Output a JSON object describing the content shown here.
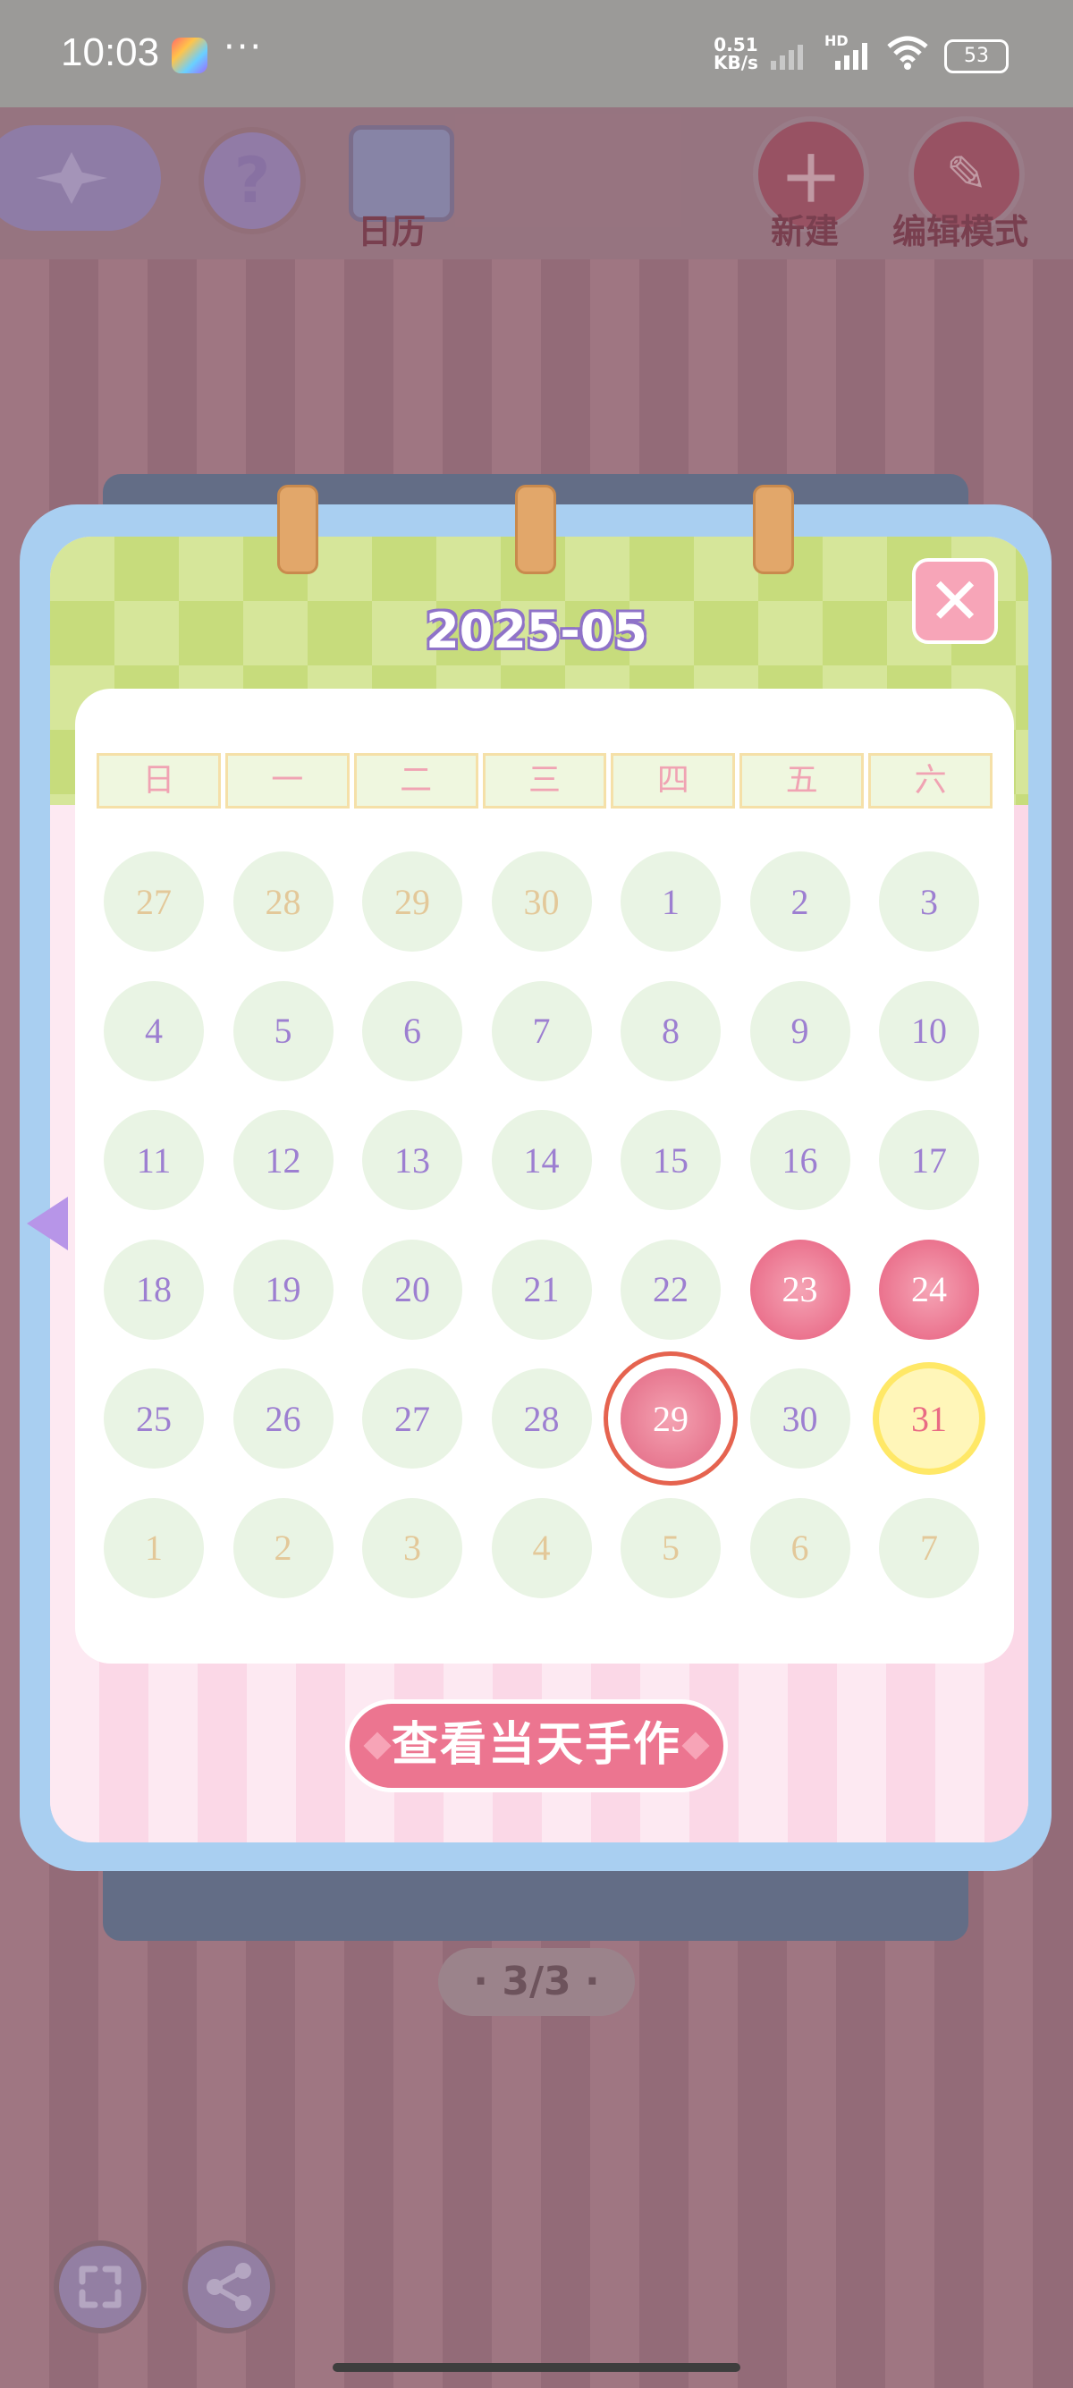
{
  "status_bar": {
    "time": "10:03",
    "more": "···",
    "net_speed_value": "0.51",
    "net_speed_unit": "KB/s",
    "hd": "HD",
    "battery": "53"
  },
  "toolbar": {
    "calendar_label": "日历",
    "help_glyph": "?",
    "new_label": "新建",
    "edit_mode_label": "编辑模式"
  },
  "calendar": {
    "title": "2025-05",
    "close_glyph": "✕",
    "weekdays": [
      "日",
      "一",
      "二",
      "三",
      "四",
      "五",
      "六"
    ],
    "weeks": [
      [
        {
          "d": "27",
          "s": "other"
        },
        {
          "d": "28",
          "s": "other"
        },
        {
          "d": "29",
          "s": "other"
        },
        {
          "d": "30",
          "s": "other"
        },
        {
          "d": "1",
          "s": "normal"
        },
        {
          "d": "2",
          "s": "normal"
        },
        {
          "d": "3",
          "s": "normal"
        }
      ],
      [
        {
          "d": "4",
          "s": "normal"
        },
        {
          "d": "5",
          "s": "normal"
        },
        {
          "d": "6",
          "s": "normal"
        },
        {
          "d": "7",
          "s": "normal"
        },
        {
          "d": "8",
          "s": "normal"
        },
        {
          "d": "9",
          "s": "normal"
        },
        {
          "d": "10",
          "s": "normal"
        }
      ],
      [
        {
          "d": "11",
          "s": "normal"
        },
        {
          "d": "12",
          "s": "normal"
        },
        {
          "d": "13",
          "s": "normal"
        },
        {
          "d": "14",
          "s": "normal"
        },
        {
          "d": "15",
          "s": "normal"
        },
        {
          "d": "16",
          "s": "normal"
        },
        {
          "d": "17",
          "s": "normal"
        }
      ],
      [
        {
          "d": "18",
          "s": "normal"
        },
        {
          "d": "19",
          "s": "normal"
        },
        {
          "d": "20",
          "s": "normal"
        },
        {
          "d": "21",
          "s": "normal"
        },
        {
          "d": "22",
          "s": "normal"
        },
        {
          "d": "23",
          "s": "marked"
        },
        {
          "d": "24",
          "s": "marked"
        }
      ],
      [
        {
          "d": "25",
          "s": "normal"
        },
        {
          "d": "26",
          "s": "normal"
        },
        {
          "d": "27",
          "s": "normal"
        },
        {
          "d": "28",
          "s": "normal"
        },
        {
          "d": "29",
          "s": "today"
        },
        {
          "d": "30",
          "s": "normal"
        },
        {
          "d": "31",
          "s": "selected"
        }
      ],
      [
        {
          "d": "1",
          "s": "other"
        },
        {
          "d": "2",
          "s": "other"
        },
        {
          "d": "3",
          "s": "other"
        },
        {
          "d": "4",
          "s": "other"
        },
        {
          "d": "5",
          "s": "other"
        },
        {
          "d": "6",
          "s": "other"
        },
        {
          "d": "7",
          "s": "other"
        }
      ]
    ],
    "view_button_label": "查看当天手作"
  },
  "pager": {
    "text": "3/3"
  },
  "colors": {
    "accent_purple": "#9d7fd1",
    "accent_pink": "#ec7590",
    "selected_yellow": "#ffe867"
  }
}
